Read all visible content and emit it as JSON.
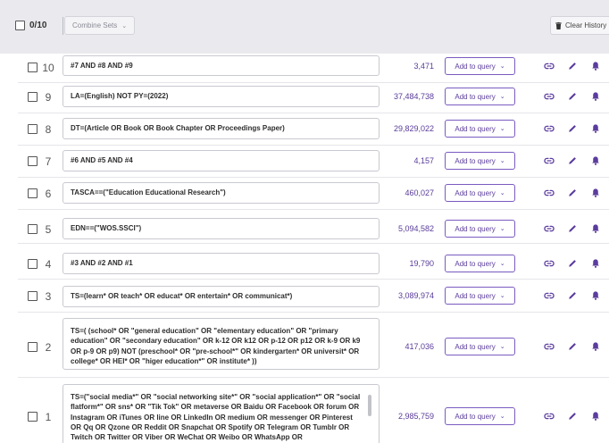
{
  "toolbar": {
    "selected_count": "0/10",
    "combine_label": "Combine Sets",
    "clear_label": "Clear History"
  },
  "add_label": "Add to query",
  "colors": {
    "accent": "#5b3c9e",
    "toolbar_bg": "#eaeaee",
    "count_text": "#5a3c9a"
  },
  "icons": [
    "checkbox",
    "chevron-down-icon",
    "trash-icon",
    "link-icon",
    "pencil-icon",
    "bell-icon"
  ],
  "rows": [
    {
      "num": "10",
      "query": "#7 AND #8 AND #9",
      "count": "3,471"
    },
    {
      "num": "9",
      "query": "LA=(English) NOT PY=(2022)",
      "count": "37,484,738"
    },
    {
      "num": "8",
      "query": "DT=(Article OR Book OR Book Chapter OR Proceedings Paper)",
      "count": "29,829,022"
    },
    {
      "num": "7",
      "query": "#6 AND #5 AND #4",
      "count": "4,157"
    },
    {
      "num": "6",
      "query": "TASCA==(\"Education Educational Research\")",
      "count": "460,027"
    },
    {
      "num": "5",
      "query": "EDN==(\"WOS.SSCI\")",
      "count": "5,094,582"
    },
    {
      "num": "4",
      "query": "#3 AND #2 AND #1",
      "count": "19,790"
    },
    {
      "num": "3",
      "query": "TS=(learn* OR teach* OR educat* OR entertain* OR communicat*)",
      "count": "3,089,974"
    },
    {
      "num": "2",
      "query": "TS=( (school* OR \"general education\" OR \"elementary education\" OR \"primary education\" OR \"secondary education\" OR k-12 OR k12 OR p-12 OR p12 OR k-9 OR k9 OR p-9 OR p9) NOT (preschool* OR \"pre-school*\" OR kindergarten* OR universit* OR college* OR HEI* OR \"higer education*\" OR institute* ))",
      "count": "417,036"
    },
    {
      "num": "1",
      "query": "TS=(\"social media*\" OR \"social networking site*\" OR \"social application*\" OR \"social flatform*\" OR sns* OR \"Tik Tok\" OR metaverse OR Baidu OR Facebook OR forum OR Instagram OR iTunes OR line OR LinkedIn OR medium OR messenger OR Pinterest OR Qq OR Qzone OR Reddit OR Snapchat OR Spotify OR Telegram OR Tumblr OR Twitch OR Twitter OR Viber OR WeChat OR Weibo OR WhatsApp OR",
      "count": "2,985,759"
    }
  ]
}
